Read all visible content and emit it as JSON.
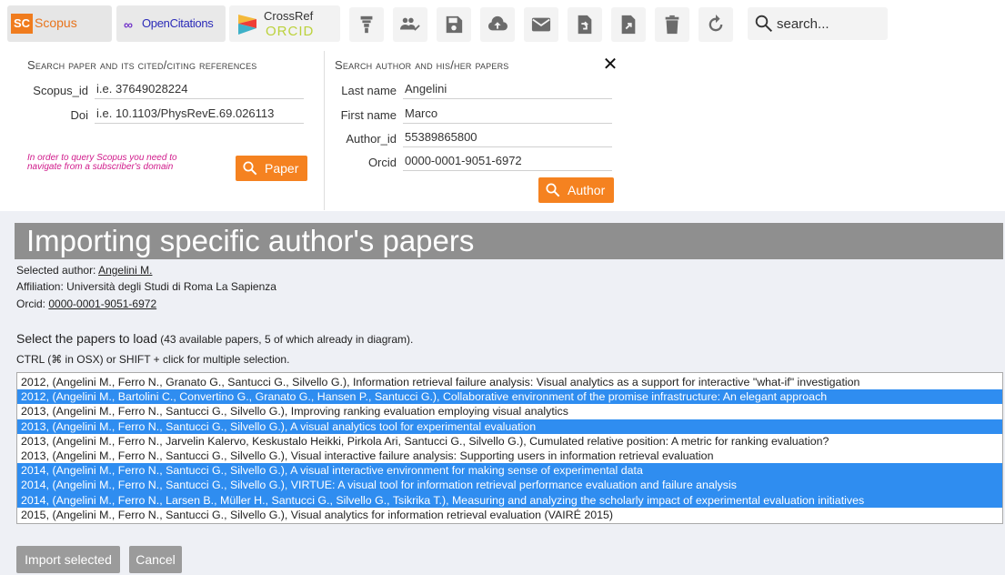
{
  "toolbar": {
    "tabs": {
      "scopus": {
        "logo": "SC",
        "label": "Scopus"
      },
      "opencitations": {
        "logo": "∞",
        "label": "OpenCitations"
      },
      "crossref": {
        "label_top": "CrossRef",
        "label_bottom": "ORCID"
      }
    },
    "buttons": [
      "filter-icon",
      "user-group-icon",
      "save-icon",
      "cloud-upload-icon",
      "mail-icon",
      "file-import-icon",
      "file-export-icon",
      "trash-icon",
      "refresh-icon"
    ],
    "search": {
      "placeholder": "search..."
    }
  },
  "paper_search": {
    "title": "Search paper and its cited/citing references",
    "scopus_label": "Scopus_id",
    "scopus_placeholder": "i.e. 37649028224",
    "doi_label": "Doi",
    "doi_placeholder": "i.e. 10.1103/PhysRevE.69.026113",
    "note_line1": "In order to query Scopus you need to",
    "note_line2": "navigate from a subscriber's domain",
    "button_label": "Paper"
  },
  "author_search": {
    "title": "Search author and his/her papers",
    "last_name_label": "Last name",
    "last_name_value": "Angelini",
    "first_name_label": "First name",
    "first_name_value": "Marco",
    "author_id_label": "Author_id",
    "author_id_value": "55389865800",
    "orcid_label": "Orcid",
    "orcid_value": "0000-0001-9051-6972",
    "button_label": "Author",
    "close": "✕"
  },
  "import": {
    "title": "Importing specific author's papers",
    "selected_author_label": "Selected author: ",
    "selected_author": "Angelini M.",
    "affiliation": "Affiliation: Università degli Studi di Roma La Sapienza",
    "orcid_label": "Orcid: ",
    "orcid": "0000-0001-9051-6972",
    "select_title": "Select the papers to load",
    "select_count": " (43 available papers, 5 of which already in diagram).",
    "hint": "CTRL (⌘ in OSX) or SHIFT + click for multiple selection.",
    "papers": [
      {
        "text": "2012, (Angelini M., Ferro N., Granato G., Santucci G., Silvello G.), Information retrieval failure analysis: Visual analytics as a support for interactive \"what-if\" investigation",
        "selected": false
      },
      {
        "text": "2012, (Angelini M., Bartolini C., Convertino G., Granato G., Hansen P., Santucci G.), Collaborative environment of the promise infrastructure: An elegant approach",
        "selected": true
      },
      {
        "text": "2013, (Angelini M., Ferro N., Santucci G., Silvello G.), Improving ranking evaluation employing visual analytics",
        "selected": false
      },
      {
        "text": "2013, (Angelini M., Ferro N., Santucci G., Silvello G.), A visual analytics tool for experimental evaluation",
        "selected": true
      },
      {
        "text": "2013, (Angelini M., Ferro N., Jarvelin Kalervo, Keskustalo Heikki, Pirkola Ari, Santucci G., Silvello G.), Cumulated relative position: A metric for ranking evaluation?",
        "selected": false
      },
      {
        "text": "2013, (Angelini M., Ferro N., Santucci G., Silvello G.), Visual interactive failure analysis: Supporting users in information retrieval evaluation",
        "selected": false
      },
      {
        "text": "2014, (Angelini M., Ferro N., Santucci G., Silvello G.), A visual interactive environment for making sense of experimental data",
        "selected": true
      },
      {
        "text": "2014, (Angelini M., Ferro N., Santucci G., Silvello G.), VIRTUE: A visual tool for information retrieval performance evaluation and failure analysis",
        "selected": true
      },
      {
        "text": "2014, (Angelini M., Ferro N., Larsen B., Müller H., Santucci G., Silvello G., Tsikrika T.), Measuring and analyzing the scholarly impact of experimental evaluation initiatives",
        "selected": true
      },
      {
        "text": "2015, (Angelini M., Ferro N., Santucci G., Silvello G.), Visual analytics for information retrieval evaluation (VAIRÉ 2015)",
        "selected": false
      }
    ],
    "import_button": "Import selected",
    "cancel_button": "Cancel"
  },
  "colors": {
    "accent_orange": "#f58220",
    "selection_blue": "#2f8df0",
    "header_gray": "#8f8f8f",
    "note_magenta": "#d0198a"
  }
}
